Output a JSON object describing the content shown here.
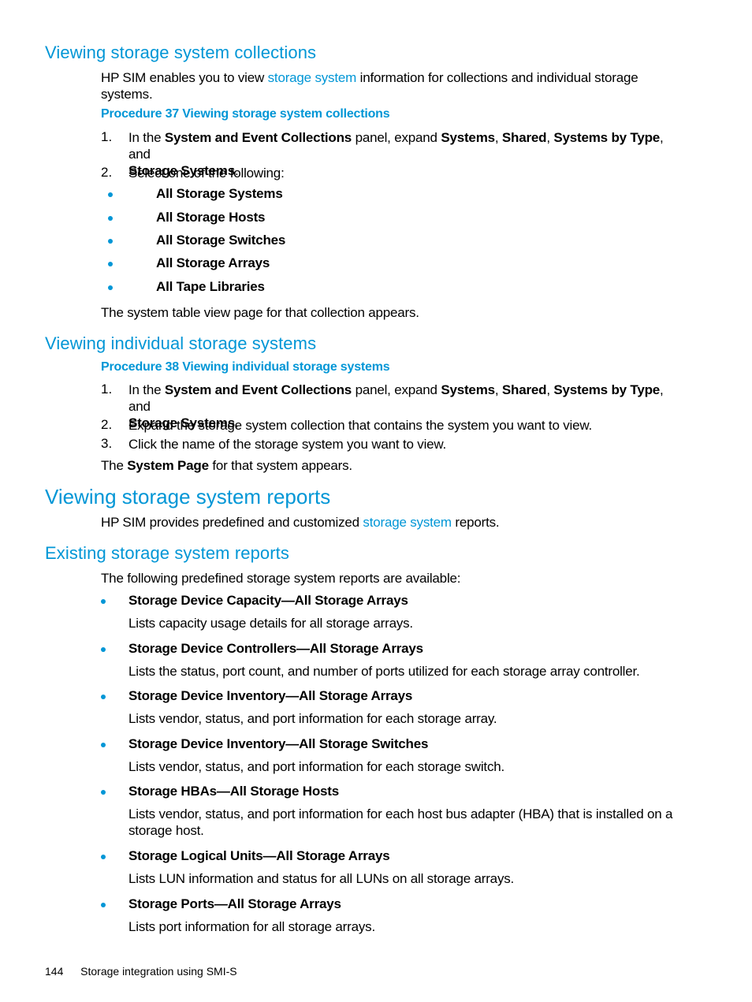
{
  "section1": {
    "heading": "Viewing storage system collections",
    "intro_before": "HP SIM enables you to view ",
    "intro_link": "storage system",
    "intro_after": " information for collections and individual storage systems.",
    "procedure_title": "Procedure 37 Viewing storage system collections",
    "steps": [
      {
        "number": "1.",
        "t1": "In the ",
        "b1": "System and Event Collections",
        "t2": " panel, expand ",
        "b2": "Systems",
        "t3": ", ",
        "b3": "Shared",
        "t4": ", ",
        "b4": "Systems by Type",
        "t5": ", and ",
        "b5": "Storage Systems",
        "t6": "."
      },
      {
        "number": "2.",
        "text": "Select one of the following:"
      }
    ],
    "options": [
      "All Storage Systems",
      "All Storage Hosts",
      "All Storage Switches",
      "All Storage Arrays",
      "All Tape Libraries"
    ],
    "result": "The system table view page for that collection appears."
  },
  "section2": {
    "heading": "Viewing individual storage systems",
    "procedure_title": "Procedure 38 Viewing individual storage systems",
    "steps": [
      {
        "number": "1.",
        "t1": "In the ",
        "b1": "System and Event Collections",
        "t2": " panel, expand ",
        "b2": "Systems",
        "t3": ", ",
        "b3": "Shared",
        "t4": ", ",
        "b4": "Systems by Type",
        "t5": ", and ",
        "b5": "Storage Systems",
        "t6": "."
      },
      {
        "number": "2.",
        "text": "Expand the storage system collection that contains the system you want to view."
      },
      {
        "number": "3.",
        "text": "Click the name of the storage system you want to view."
      }
    ],
    "result_before": "The ",
    "result_bold": "System Page",
    "result_after": " for that system appears."
  },
  "section3": {
    "heading": "Viewing storage system reports",
    "intro_before": "HP SIM provides predefined and customized ",
    "intro_link": "storage system",
    "intro_after": " reports."
  },
  "section4": {
    "heading": "Existing storage system reports",
    "intro": "The following predefined storage system reports are available:",
    "reports": [
      {
        "title": "Storage Device Capacity—All Storage Arrays",
        "description": "Lists capacity usage details for all storage arrays."
      },
      {
        "title": "Storage Device Controllers—All Storage Arrays",
        "description": "Lists the status, port count, and number of ports utilized for each storage array controller."
      },
      {
        "title": "Storage Device Inventory—All Storage Arrays",
        "description": "Lists vendor, status, and port information for each storage array."
      },
      {
        "title": "Storage Device Inventory—All Storage Switches",
        "description": "Lists vendor, status, and port information for each storage switch."
      },
      {
        "title": "Storage HBAs—All Storage Hosts",
        "description": "Lists vendor, status, and port information for each host bus adapter (HBA) that is installed on a storage host."
      },
      {
        "title": "Storage Logical Units—All Storage Arrays",
        "description": "Lists LUN information and status for all LUNs on all storage arrays."
      },
      {
        "title": "Storage Ports—All Storage Arrays",
        "description": "Lists port information for all storage arrays."
      }
    ]
  },
  "footer": {
    "page_number": "144",
    "chapter": "Storage integration using SMI-S"
  },
  "colors": {
    "accent": "#0096d6",
    "text": "#000000"
  }
}
